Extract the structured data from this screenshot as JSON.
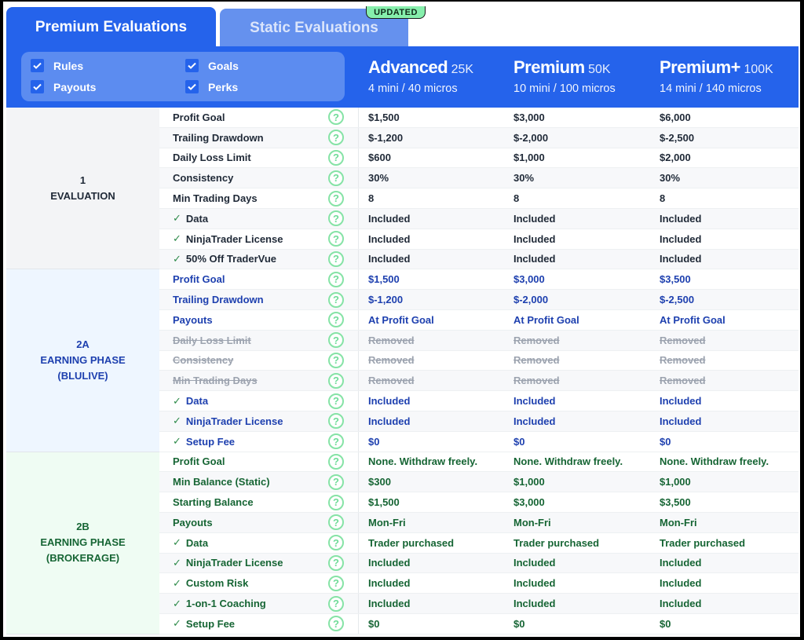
{
  "tabs": {
    "premium_label": "Premium Evaluations",
    "static_label": "Static Evaluations",
    "static_badge": "UPDATED"
  },
  "filters": [
    {
      "label": "Rules",
      "checked": true
    },
    {
      "label": "Payouts",
      "checked": true
    },
    {
      "label": "Goals",
      "checked": true
    },
    {
      "label": "Perks",
      "checked": true
    }
  ],
  "plans": [
    {
      "name": "Advanced",
      "size": "25K",
      "contracts": "4 mini / 40 micros"
    },
    {
      "name": "Premium",
      "size": "50K",
      "contracts": "10 mini / 100 micros"
    },
    {
      "name": "Premium+",
      "size": "100K",
      "contracts": "14 mini / 140 micros"
    }
  ],
  "sections": [
    {
      "id": "evaluation",
      "number": "1",
      "title": "EVALUATION",
      "subtitle": "",
      "rows": [
        {
          "label": "Profit Goal",
          "check": false,
          "values": [
            "$1,500",
            "$3,000",
            "$6,000"
          ]
        },
        {
          "label": "Trailing Drawdown",
          "check": false,
          "values": [
            "$-1,200",
            "$-2,000",
            "$-2,500"
          ]
        },
        {
          "label": "Daily Loss Limit",
          "check": false,
          "values": [
            "$600",
            "$1,000",
            "$2,000"
          ]
        },
        {
          "label": "Consistency",
          "check": false,
          "values": [
            "30%",
            "30%",
            "30%"
          ]
        },
        {
          "label": "Min Trading Days",
          "check": false,
          "values": [
            "8",
            "8",
            "8"
          ]
        },
        {
          "label": "Data",
          "check": true,
          "values": [
            "Included",
            "Included",
            "Included"
          ]
        },
        {
          "label": "NinjaTrader License",
          "check": true,
          "values": [
            "Included",
            "Included",
            "Included"
          ]
        },
        {
          "label": "50% Off TraderVue",
          "check": true,
          "values": [
            "Included",
            "Included",
            "Included"
          ]
        }
      ]
    },
    {
      "id": "earning-blulive",
      "number": "2A",
      "title": "EARNING PHASE",
      "subtitle": "(BLULIVE)",
      "rows": [
        {
          "label": "Profit Goal",
          "check": false,
          "values": [
            "$1,500",
            "$3,000",
            "$3,500"
          ]
        },
        {
          "label": "Trailing Drawdown",
          "check": false,
          "values": [
            "$-1,200",
            "$-2,000",
            "$-2,500"
          ]
        },
        {
          "label": "Payouts",
          "check": false,
          "values": [
            "At Profit Goal",
            "At Profit Goal",
            "At Profit Goal"
          ]
        },
        {
          "label": "Daily Loss Limit",
          "check": false,
          "removed": true,
          "values": [
            "Removed",
            "Removed",
            "Removed"
          ]
        },
        {
          "label": "Consistency",
          "check": false,
          "removed": true,
          "values": [
            "Removed",
            "Removed",
            "Removed"
          ]
        },
        {
          "label": "Min Trading Days",
          "check": false,
          "removed": true,
          "values": [
            "Removed",
            "Removed",
            "Removed"
          ]
        },
        {
          "label": "Data",
          "check": true,
          "values": [
            "Included",
            "Included",
            "Included"
          ]
        },
        {
          "label": "NinjaTrader License",
          "check": true,
          "values": [
            "Included",
            "Included",
            "Included"
          ]
        },
        {
          "label": "Setup Fee",
          "check": true,
          "values": [
            "$0",
            "$0",
            "$0"
          ]
        }
      ]
    },
    {
      "id": "earning-brokerage",
      "number": "2B",
      "title": "EARNING PHASE",
      "subtitle": "(BROKERAGE)",
      "rows": [
        {
          "label": "Profit Goal",
          "check": false,
          "values": [
            "None. Withdraw freely.",
            "None. Withdraw freely.",
            "None. Withdraw freely."
          ]
        },
        {
          "label": "Min Balance (Static)",
          "check": false,
          "values": [
            "$300",
            "$1,000",
            "$1,000"
          ]
        },
        {
          "label": "Starting Balance",
          "check": false,
          "values": [
            "$1,500",
            "$3,000",
            "$3,500"
          ]
        },
        {
          "label": "Payouts",
          "check": false,
          "values": [
            "Mon-Fri",
            "Mon-Fri",
            "Mon-Fri"
          ]
        },
        {
          "label": "Data",
          "check": true,
          "values": [
            "Trader purchased",
            "Trader purchased",
            "Trader purchased"
          ]
        },
        {
          "label": "NinjaTrader License",
          "check": true,
          "values": [
            "Included",
            "Included",
            "Included"
          ]
        },
        {
          "label": "Custom Risk",
          "check": true,
          "values": [
            "Included",
            "Included",
            "Included"
          ]
        },
        {
          "label": "1-on-1 Coaching",
          "check": true,
          "values": [
            "Included",
            "Included",
            "Included"
          ]
        },
        {
          "label": "Setup Fee",
          "check": true,
          "values": [
            "$0",
            "$0",
            "$0"
          ]
        }
      ]
    }
  ],
  "icons": {
    "help": "?",
    "check": "✓"
  },
  "colors": {
    "primary_blue": "#2563eb",
    "inactive_tab": "#6591ee",
    "badge_green": "#86efac",
    "help_icon_green": "#6fdc98",
    "section1_text": "#1f2937",
    "section2a_text": "#1e40af",
    "section2b_text": "#166534"
  }
}
